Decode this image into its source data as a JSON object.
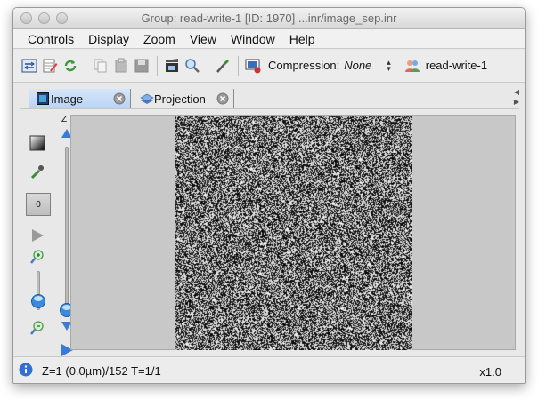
{
  "window": {
    "title": "Group: read-write-1 [ID: 1970] ...inr/image_sep.inr"
  },
  "menu": {
    "items": [
      "Controls",
      "Display",
      "Zoom",
      "View",
      "Window",
      "Help"
    ]
  },
  "toolbar": {
    "compression_label": "Compression:",
    "compression_value": "None",
    "group_label": "read-write-1",
    "icons": [
      "open-icon",
      "edit-icon",
      "refresh-icon",
      "copy-icon",
      "paste-icon",
      "save-icon",
      "clapboard-icon",
      "zoom-icon",
      "brush-icon",
      "screenshot-icon",
      "group-icon"
    ]
  },
  "tabs": [
    {
      "label": "Image",
      "active": true,
      "icon": "image-icon"
    },
    {
      "label": "Projection",
      "active": false,
      "icon": "layers-icon"
    }
  ],
  "left_panel": {
    "zero_button": "0",
    "z_label": "Z",
    "icons": [
      "gradient-icon",
      "eyedropper-icon",
      "play-icon",
      "zoom-in-icon",
      "zoom-out-icon",
      "slider-knob-icon"
    ]
  },
  "status": {
    "text": "Z=1 (0.0µm)/152 T=1/1",
    "zoom": "x1.0"
  },
  "colors": {
    "accent": "#2f6fd6",
    "tab_active": "#c8dcf7",
    "viewport_bg": "#c8c8c8"
  }
}
